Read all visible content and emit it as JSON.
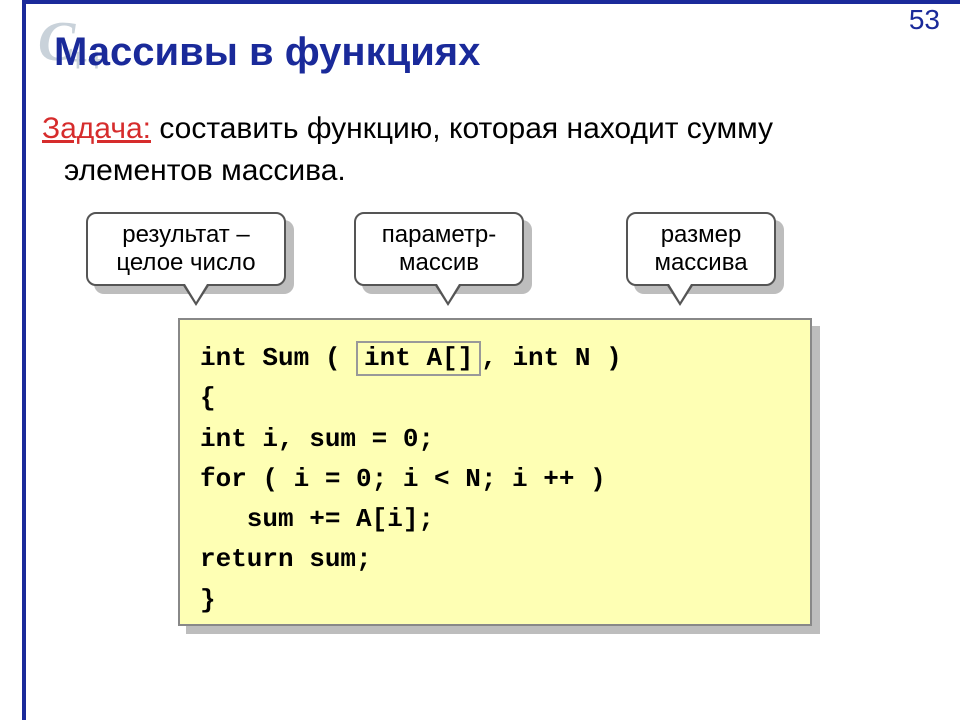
{
  "page_number": "53",
  "bg_logo": {
    "main": "C",
    "sub": "++"
  },
  "heading": "Массивы в функциях",
  "task": {
    "label": "Задача:",
    "text_line1": " составить функцию, которая находит сумму",
    "text_line2": "элементов массива."
  },
  "callouts": {
    "c1_line1": "результат –",
    "c1_line2": "целое число",
    "c2_line1": "параметр-",
    "c2_line2": "массив",
    "c3_line1": "размер",
    "c3_line2": "массива"
  },
  "code": {
    "sig_pre": "int Sum ( ",
    "sig_param": "int A[]",
    "sig_post": ", int N )",
    "l2": "{",
    "l3": "int i, sum = 0;",
    "l4": "for ( i = 0; i < N; i ++ )",
    "l5": "   sum += A[i];",
    "l6": "return sum;",
    "l7": "}"
  }
}
